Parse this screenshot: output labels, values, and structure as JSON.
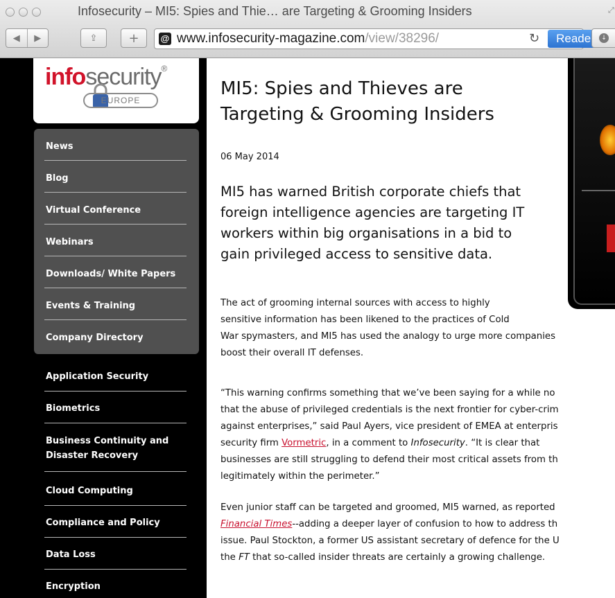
{
  "window": {
    "title": "Infosecurity – MI5: Spies and Thie… are Targeting & Grooming Insiders",
    "address_host": "www.infosecurity-magazine.com",
    "address_path": "/view/38296/",
    "reader_label": "Reader"
  },
  "logo": {
    "text_a": "info",
    "text_b": "security",
    "registered": "®",
    "region": "EUROPE"
  },
  "nav_primary": [
    {
      "label": "News"
    },
    {
      "label": "Blog"
    },
    {
      "label": "Virtual Conference"
    },
    {
      "label": "Webinars"
    },
    {
      "label": "Downloads/ White Papers"
    },
    {
      "label": "Events & Training"
    },
    {
      "label": "Company Directory"
    }
  ],
  "nav_topics": [
    {
      "label": "Application Security"
    },
    {
      "label": "Biometrics"
    },
    {
      "label": "Business Continuity and"
    },
    {
      "label": "Disaster Recovery"
    },
    {
      "label": "Cloud Computing"
    },
    {
      "label": "Compliance and Policy"
    },
    {
      "label": "Data Loss"
    },
    {
      "label": "Encryption"
    }
  ],
  "article": {
    "title_line1": "MI5: Spies and Thieves are",
    "title_line2": "Targeting & Grooming Insiders",
    "date": "06 May 2014",
    "lede": [
      "MI5 has warned British corporate chiefs that",
      "foreign intelligence agencies are targeting IT",
      "workers within big organisations in a bid to",
      "gain privileged access to sensitive data."
    ],
    "p1": [
      "The act of grooming internal sources with access to highly",
      "sensitive information has been likened to the practices of Cold",
      "War spymasters, and MI5 has used the analogy to urge more companies",
      "boost their overall IT defenses."
    ],
    "p2_l1": "“This warning confirms something that we’ve been saying for a while no",
    "p2_l2": "that the abuse of privileged credentials is the next frontier for cyber-crim",
    "p2_l3": "against enterprises,” said Paul Ayers, vice president of EMEA at enterpris",
    "p2_l4_a": "security firm ",
    "p2_l4_link": "Vormetric",
    "p2_l4_b": ", in a comment to ",
    "p2_l4_it": "Infosecurity",
    "p2_l4_c": ". “It is clear that",
    "p2_l5": "businesses are still struggling to defend their most critical assets from th",
    "p2_l6": "legitimately within the perimeter.”",
    "p3_l1": "Even junior staff can be targeted and groomed, MI5 warned, as reported",
    "p3_l2_link": "Financial Times",
    "p3_l2_b": "--adding a deeper layer of confusion to how to address th",
    "p3_l3": "issue. Paul Stockton, a former US assistant secretary of defence for the U",
    "p3_l4_a": "the ",
    "p3_l4_it": "FT",
    "p3_l4_b": " that so-called insider threats are certainly a growing challenge."
  },
  "colors": {
    "brand_red": "#d1132a",
    "reader_blue": "#2d73d1",
    "sidebar_bg": "#000000",
    "menu_bg": "#505050"
  }
}
